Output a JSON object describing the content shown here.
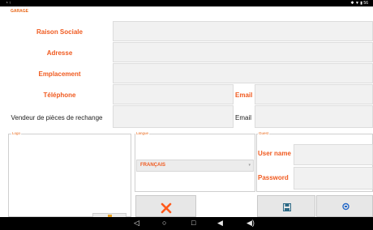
{
  "status": {
    "left_icons": "¹ ↑",
    "right_icons": "✱ ▼ ▮ 56"
  },
  "garage": {
    "section_title": "GARAGE",
    "raison_sociale": "Raison Sociale",
    "adresse": "Adresse",
    "emplacement": "Emplacement",
    "telephone": "Téléphone",
    "email_label": "Email",
    "vendeur": "Vendeur de pièces de rechange",
    "email_label_2": "Email"
  },
  "logo": {
    "title": "Logo"
  },
  "langue": {
    "title": "Langue",
    "selected": "FRANÇAIS"
  },
  "guest": {
    "title": "Guest",
    "username_label": "User name",
    "password_label": "Password"
  },
  "buttons": {
    "cancel_icon": "close-icon",
    "save_icon": "floppy-disk-icon",
    "sync_icon": "sync-icon"
  },
  "colors": {
    "accent": "#f05a1f",
    "cancel": "#ff5a1c",
    "save": "#2d6a86",
    "sync": "#2468c8"
  }
}
